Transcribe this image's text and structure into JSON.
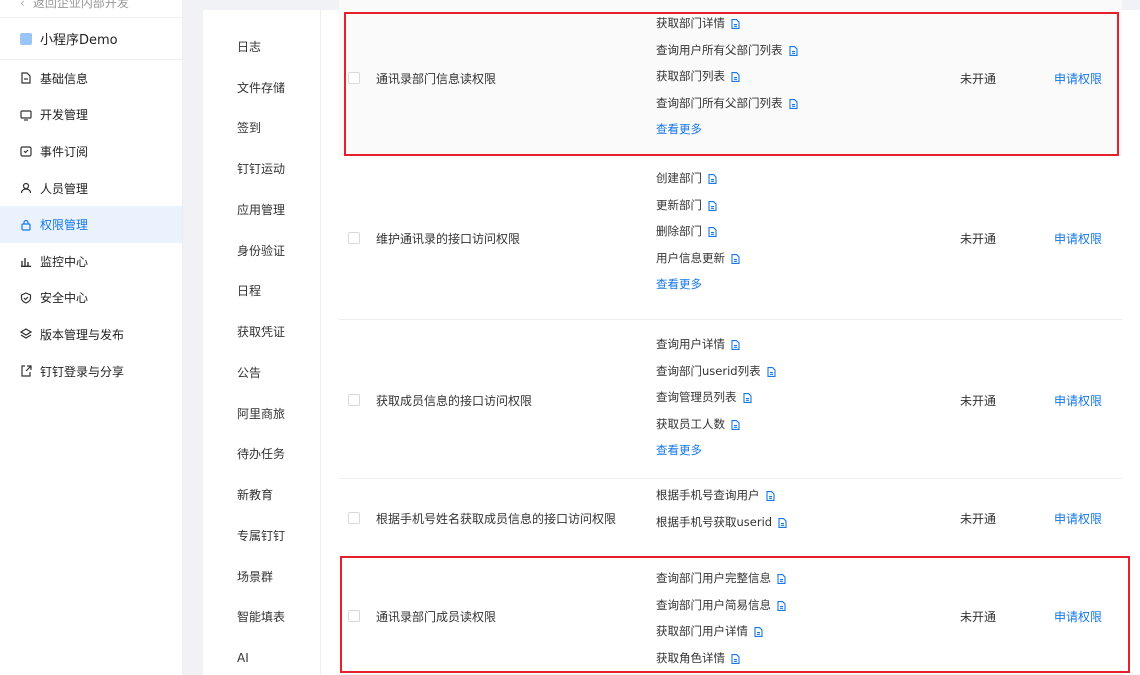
{
  "sidebar": {
    "back_label": "返回企业内部开发",
    "app_name": "小程序Demo",
    "items": [
      {
        "label": "基础信息",
        "icon": "doc-icon"
      },
      {
        "label": "开发管理",
        "icon": "monitor-icon"
      },
      {
        "label": "事件订阅",
        "icon": "calendar-icon"
      },
      {
        "label": "人员管理",
        "icon": "user-icon"
      },
      {
        "label": "权限管理",
        "icon": "lock-icon",
        "active": true
      },
      {
        "label": "监控中心",
        "icon": "bar-chart-icon"
      },
      {
        "label": "安全中心",
        "icon": "shield-icon"
      },
      {
        "label": "版本管理与发布",
        "icon": "layers-icon"
      },
      {
        "label": "钉钉登录与分享",
        "icon": "share-icon"
      }
    ]
  },
  "categories": [
    "日志",
    "文件存储",
    "签到",
    "钉钉运动",
    "应用管理",
    "身份验证",
    "日程",
    "获取凭证",
    "公告",
    "阿里商旅",
    "待办任务",
    "新教育",
    "专属钉钉",
    "场景群",
    "智能填表",
    "AI"
  ],
  "permissions": [
    {
      "name": "通讯录部门信息读权限",
      "apis": [
        "获取部门详情",
        "查询用户所有父部门列表",
        "获取部门列表",
        "查询部门所有父部门列表"
      ],
      "more": "查看更多",
      "status": "未开通",
      "action": "申请权限"
    },
    {
      "name": "维护通讯录的接口访问权限",
      "apis": [
        "创建部门",
        "更新部门",
        "删除部门",
        "用户信息更新"
      ],
      "more": "查看更多",
      "status": "未开通",
      "action": "申请权限"
    },
    {
      "name": "获取成员信息的接口访问权限",
      "apis": [
        "查询用户详情",
        "查询部门userid列表",
        "查询管理员列表",
        "获取员工人数"
      ],
      "more": "查看更多",
      "status": "未开通",
      "action": "申请权限"
    },
    {
      "name": "根据手机号姓名获取成员信息的接口访问权限",
      "apis": [
        "根据手机号查询用户",
        "根据手机号获取userid"
      ],
      "more": "",
      "status": "未开通",
      "action": "申请权限"
    },
    {
      "name": "通讯录部门成员读权限",
      "apis": [
        "查询部门用户完整信息",
        "查询部门用户简易信息",
        "获取部门用户详情",
        "获取角色详情"
      ],
      "more": "",
      "status": "未开通",
      "action": "申请权限"
    }
  ],
  "colors": {
    "accent": "#1677e8",
    "highlight": "#e5202b"
  }
}
